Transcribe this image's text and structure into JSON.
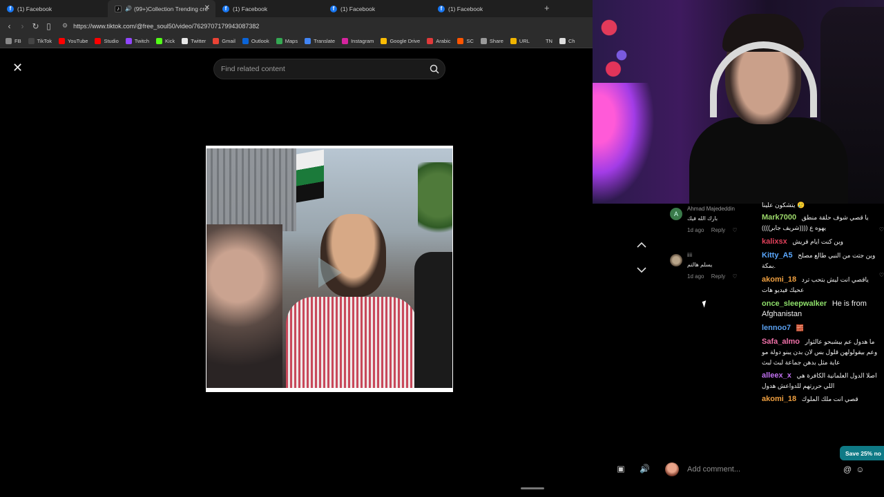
{
  "browser": {
    "tabs": [
      {
        "label": "(1) Facebook",
        "icon": "facebook-icon",
        "active": false
      },
      {
        "label": "(99+)Collection Trending cre",
        "icon": "tiktok-icon",
        "active": true
      },
      {
        "label": "(1) Facebook",
        "icon": "facebook-icon",
        "active": false
      },
      {
        "label": "(1) Facebook",
        "icon": "facebook-icon",
        "active": false
      },
      {
        "label": "(1) Facebook",
        "icon": "facebook-icon",
        "active": false
      }
    ],
    "url": "https://www.tiktok.com/@free_soul50/video/7629707179943087382",
    "bookmarks": [
      {
        "label": "FB",
        "color": "#8a8a8a"
      },
      {
        "label": "TikTok",
        "color": "#444444"
      },
      {
        "label": "YouTube",
        "color": "#ff0000"
      },
      {
        "label": "Studio",
        "color": "#ff0000"
      },
      {
        "label": "Twitch",
        "color": "#9146ff"
      },
      {
        "label": "Kick",
        "color": "#53fc18"
      },
      {
        "label": "Twitter",
        "color": "#e7e7e7"
      },
      {
        "label": "Gmail",
        "color": "#ea4335"
      },
      {
        "label": "Outlook",
        "color": "#0a64d8"
      },
      {
        "label": "Maps",
        "color": "#34a853"
      },
      {
        "label": "Translate",
        "color": "#4285f4"
      },
      {
        "label": "Instagram",
        "color": "#d6249f"
      },
      {
        "label": "Google Drive",
        "color": "#fbbc04"
      },
      {
        "label": "Arabic",
        "color": "#e03a3a"
      },
      {
        "label": "SC",
        "color": "#ff5500"
      },
      {
        "label": "Share",
        "color": "#9a9a9a"
      },
      {
        "label": "URL",
        "color": "#f0b400"
      },
      {
        "label": "TN",
        "color": "#2c2c2c"
      },
      {
        "label": "Ch",
        "color": "#dddddd"
      }
    ]
  },
  "viewer": {
    "search_placeholder": "Find related content"
  },
  "comments": [
    {
      "name": "Ahmad Majededdin",
      "text": "بارك الله فيك",
      "time": "1d ago",
      "reply": "Reply",
      "avatar_color": "#3a7a4a",
      "avatar_letter": "A"
    },
    {
      "name": "iiii",
      "text": "يسلم هالتم",
      "time": "1d ago",
      "reply": "Reply",
      "avatar_color": "#7a6a5a",
      "avatar_letter": ""
    }
  ],
  "chat": [
    {
      "user": "",
      "user_color": "#ffffff",
      "text": "يتشكون علينا 🥲"
    },
    {
      "user": "Mark7000",
      "user_color": "#9cd86a",
      "text": "يا قصي شوف حلقة منطق يهوه ع ((((شريف جابر))))"
    },
    {
      "user": "kalixsx",
      "user_color": "#e0405a",
      "text": "وين كنت ايام قريش"
    },
    {
      "user": "Kitty_A5",
      "user_color": "#5aa8ff",
      "text": "وين جتت من النبي طالع مصلح بمكة."
    },
    {
      "user": "akomi_18",
      "user_color": "#f0a040",
      "text": "ياقصي انت ليش بتحب ترد عحيك فيديو هات"
    },
    {
      "user": "once_sleepwalker",
      "user_color": "#8ee06a",
      "text": "He is from Afghanistan"
    },
    {
      "user": "lennoo7",
      "user_color": "#5aa0f0",
      "text": "🧱"
    },
    {
      "user": "Safa_almo",
      "user_color": "#f070a8",
      "text": "ما هدول عم بيشبحو عالثوار وعم بيقولولهن قلول بس لان بدن يبنو دولة مو عاية مثل بدهن جماعة لبث لبث"
    },
    {
      "user": "alleex_x",
      "user_color": "#c070f0",
      "text": "اصلا الدول العلمانية الكافرة هي اللي حررتهم للدواعش هدول"
    },
    {
      "user": "akomi_18",
      "user_color": "#f0a040",
      "text": "قصي انت ملك الملوك"
    }
  ],
  "add_comment_placeholder": "Add comment...",
  "save_button": "Save 25% no"
}
